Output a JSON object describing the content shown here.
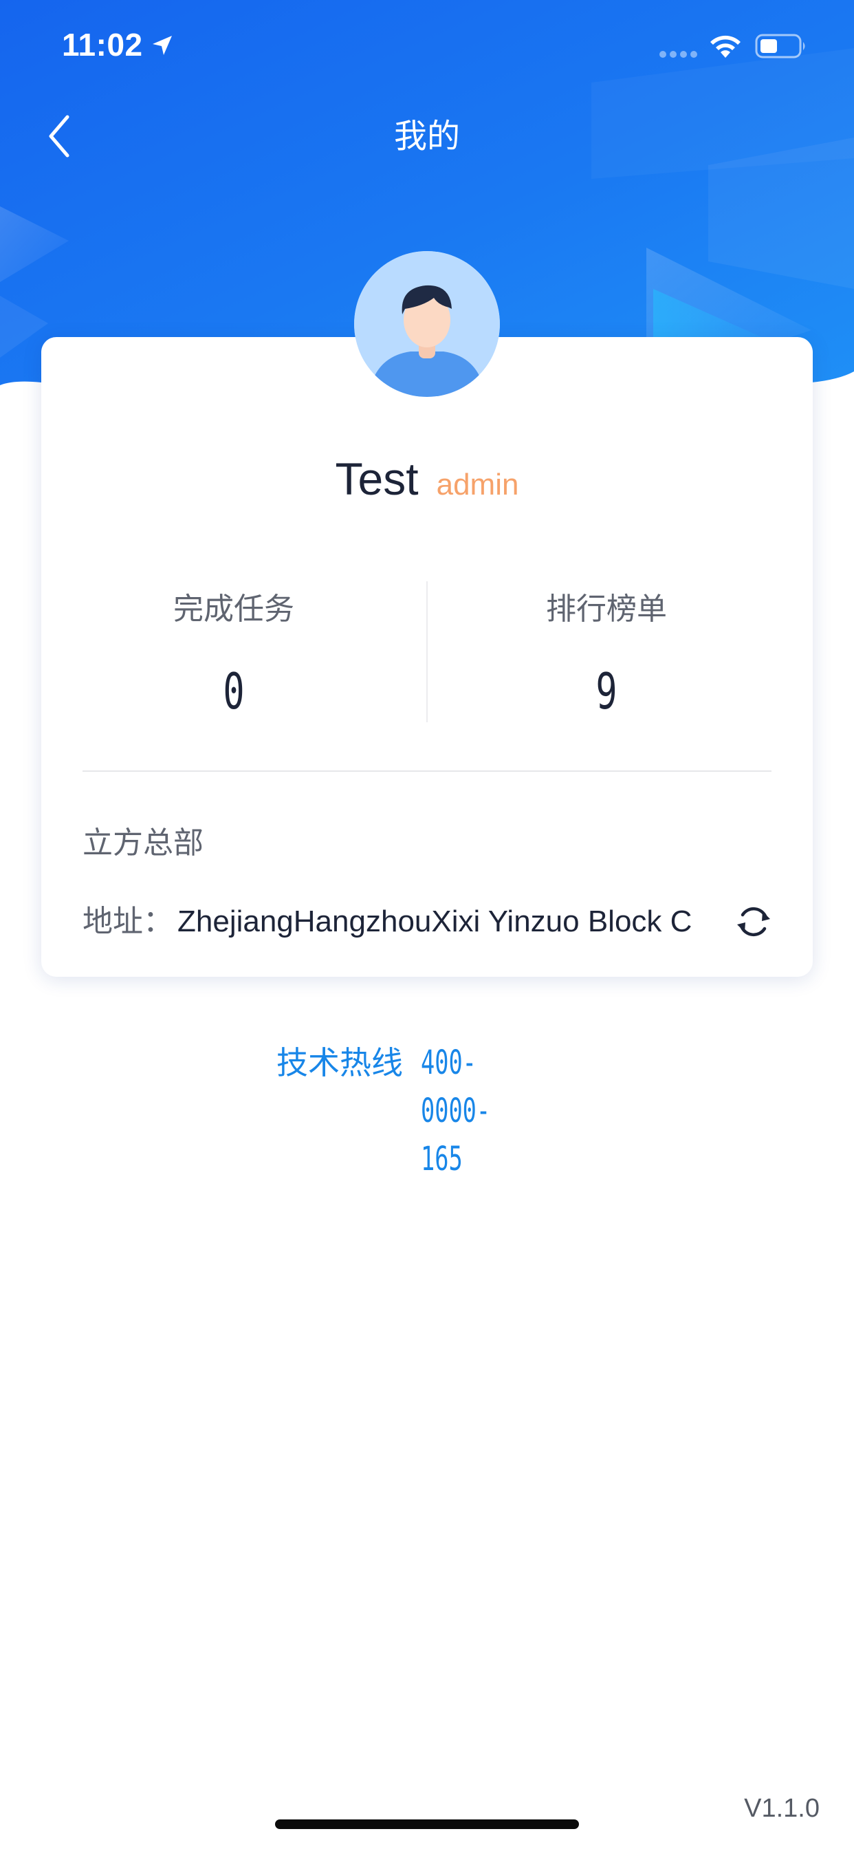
{
  "status_bar": {
    "time": "11:02"
  },
  "nav": {
    "title": "我的"
  },
  "profile": {
    "name": "Test",
    "role": "admin"
  },
  "stats": {
    "tasks_label": "完成任务",
    "tasks_value": "0",
    "rank_label": "排行榜单",
    "rank_value": "9"
  },
  "org": {
    "name": "立方总部",
    "address_label": "地址：",
    "address_value": "ZhejiangHangzhouXixi Yinzuo Block C"
  },
  "hotline": {
    "label": "技术热线",
    "number": "400-0000-165"
  },
  "footer": {
    "version": "V1.1.0"
  },
  "colors": {
    "header_blue": "#1a73f0",
    "accent_orange": "#f6a26a",
    "link_blue": "#1886e8",
    "text_dark": "#1d2438",
    "text_gray": "#5f6470"
  },
  "icons": {
    "back": "chevron-left-icon",
    "location": "location-arrow-icon",
    "signal": "cellular-signal-icon",
    "wifi": "wifi-icon",
    "battery": "battery-icon",
    "refresh": "refresh-icon"
  }
}
